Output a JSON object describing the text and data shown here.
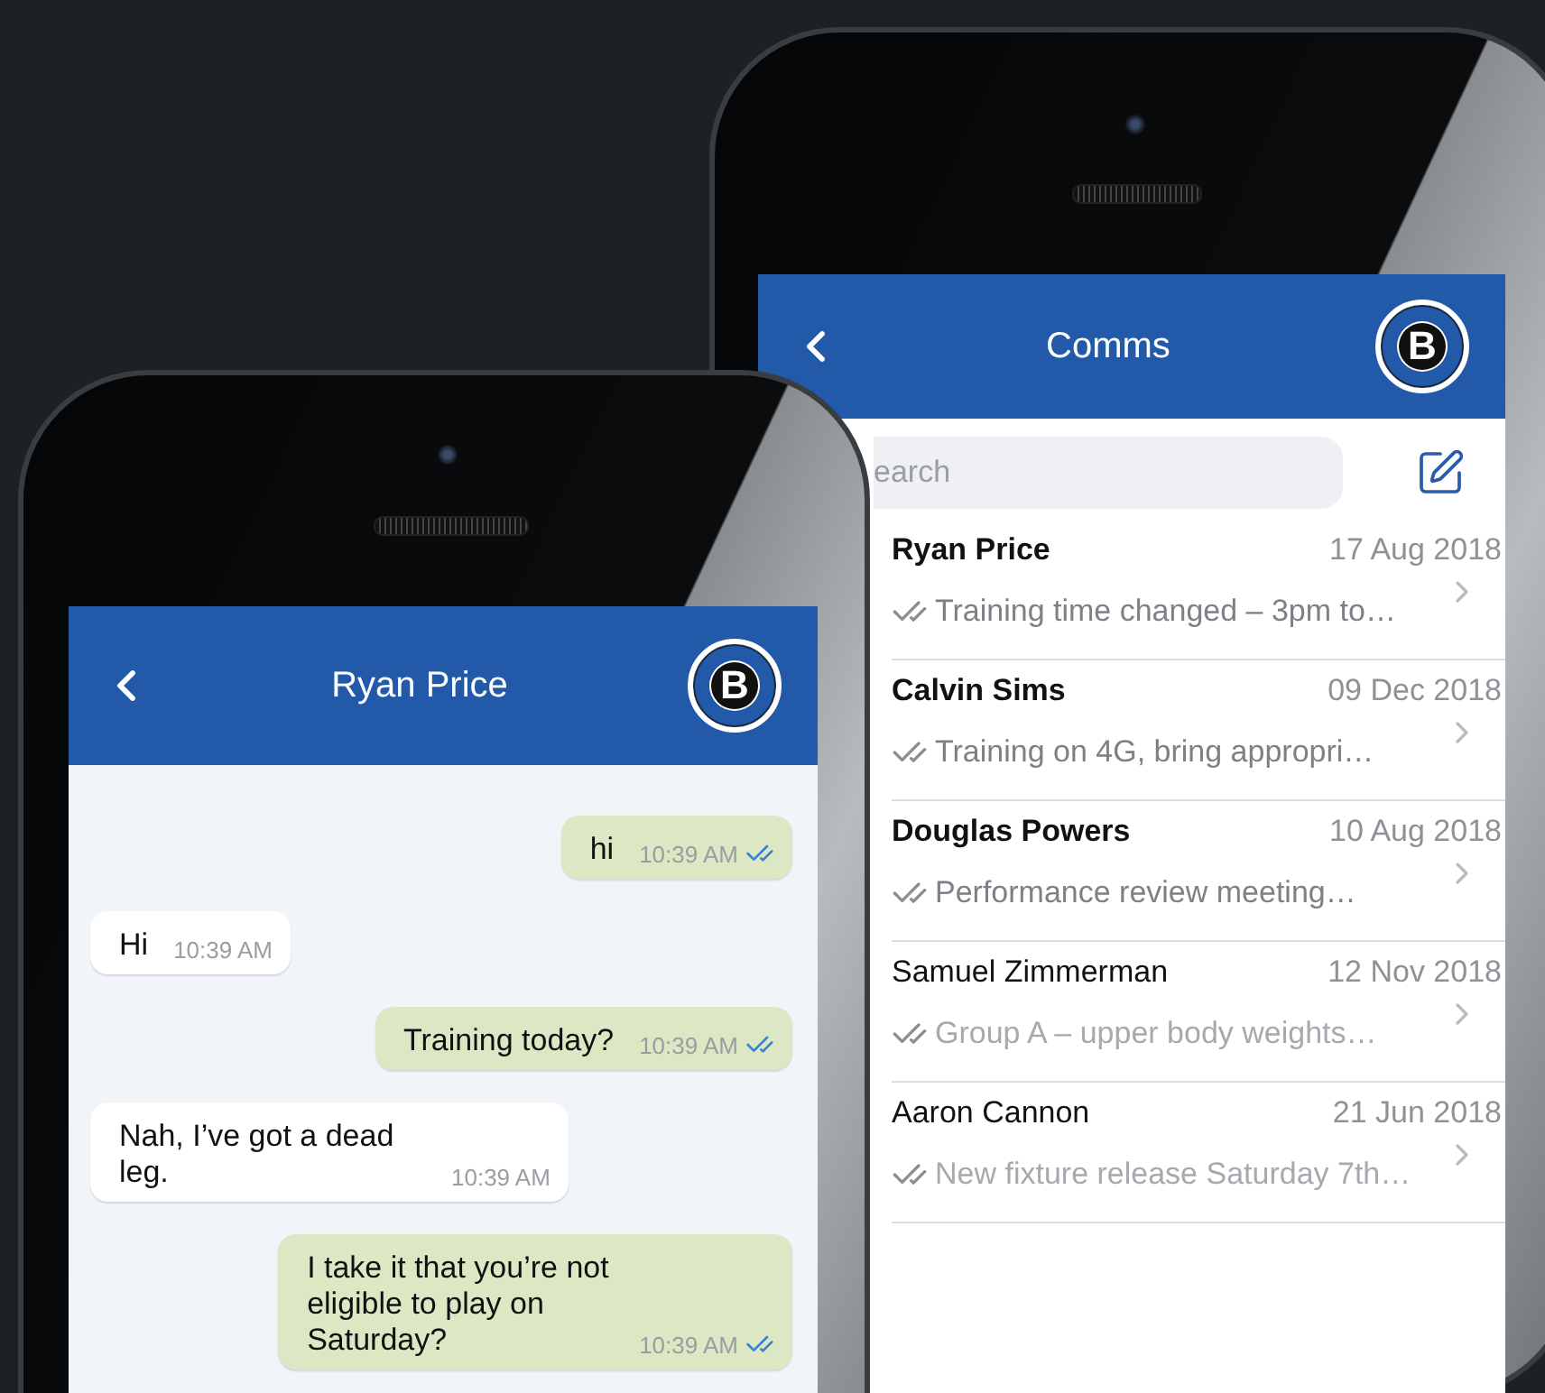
{
  "comms_screen": {
    "header": {
      "title": "Comms",
      "logo_letter": "B"
    },
    "search": {
      "placeholder": "earch"
    },
    "conversations": [
      {
        "name": "Ryan Price",
        "date": "17 Aug 2018",
        "preview": "Training time changed – 3pm to…",
        "unread": true
      },
      {
        "name": "Calvin Sims",
        "date": "09 Dec 2018",
        "preview": "Training on 4G, bring appropri…",
        "unread": true
      },
      {
        "name": "Douglas Powers",
        "date": "10 Aug 2018",
        "preview": "Performance review meeting…",
        "unread": true
      },
      {
        "name": "Samuel Zimmerman",
        "date": "12 Nov 2018",
        "preview": "Group A – upper body weights…",
        "unread": false
      },
      {
        "name": "Aaron Cannon",
        "date": "21 Jun 2018",
        "preview": "New fixture release Saturday 7th…",
        "unread": false
      }
    ]
  },
  "chat_screen": {
    "header": {
      "title": "Ryan Price",
      "logo_letter": "B"
    },
    "messages": [
      {
        "kind": "outgoing",
        "text": "hi",
        "time": "10:39 AM",
        "read": true
      },
      {
        "kind": "incoming",
        "text": "Hi",
        "time": "10:39 AM"
      },
      {
        "kind": "outgoing",
        "text": "Training today?",
        "time": "10:39 AM",
        "read": true
      },
      {
        "kind": "incoming",
        "text": "Nah, I’ve got a dead leg.",
        "time": "10:39 AM"
      },
      {
        "kind": "outgoing",
        "text": "I take it that you’re not eligible to play on Saturday?",
        "time": "10:39 AM",
        "read": true
      }
    ]
  }
}
